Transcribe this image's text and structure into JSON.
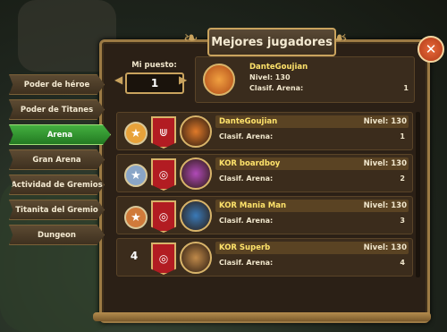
{
  "title": "Mejores jugadores",
  "close_label": "✕",
  "tabs": [
    {
      "label": "Poder de héroe",
      "active": false
    },
    {
      "label": "Poder de Titanes",
      "active": false
    },
    {
      "label": "Arena",
      "active": true
    },
    {
      "label": "Gran Arena",
      "active": false
    },
    {
      "label": "Actividad de Gremios",
      "active": false
    },
    {
      "label": "Titanita del Gremio",
      "active": false
    },
    {
      "label": "Dungeon",
      "active": false
    }
  ],
  "my_position": {
    "label": "Mi puesto:",
    "value": "1",
    "player": {
      "name": "DanteGoujian",
      "level": "Nivel: 130",
      "arena_label": "Clasif. Arena:",
      "arena_value": "1"
    }
  },
  "rows": [
    {
      "medal": "★",
      "medal_color": "#e8a23a",
      "rank_text": "",
      "name": "DanteGoujian",
      "level": "Nivel: 130",
      "arena_label": "Clasif. Arena:",
      "arena_value": "1",
      "banner_icon": "⋓",
      "avatar_color": "#e07a2a"
    },
    {
      "medal": "★",
      "medal_color": "#8aa6c8",
      "rank_text": "",
      "name": "KOR boardboy",
      "level": "Nivel: 130",
      "arena_label": "Clasif. Arena:",
      "arena_value": "2",
      "banner_icon": "◎",
      "avatar_color": "#b04ab8"
    },
    {
      "medal": "★",
      "medal_color": "#d07a3a",
      "rank_text": "",
      "name": "KOR Mania Man",
      "level": "Nivel: 130",
      "arena_label": "Clasif. Arena:",
      "arena_value": "3",
      "banner_icon": "◎",
      "avatar_color": "#3a7ab8"
    },
    {
      "medal": "",
      "medal_color": "",
      "rank_text": "4",
      "name": "KOR Superb",
      "level": "Nivel: 130",
      "arena_label": "Clasif. Arena:",
      "arena_value": "4",
      "banner_icon": "◎",
      "avatar_color": "#c08a4a"
    }
  ]
}
